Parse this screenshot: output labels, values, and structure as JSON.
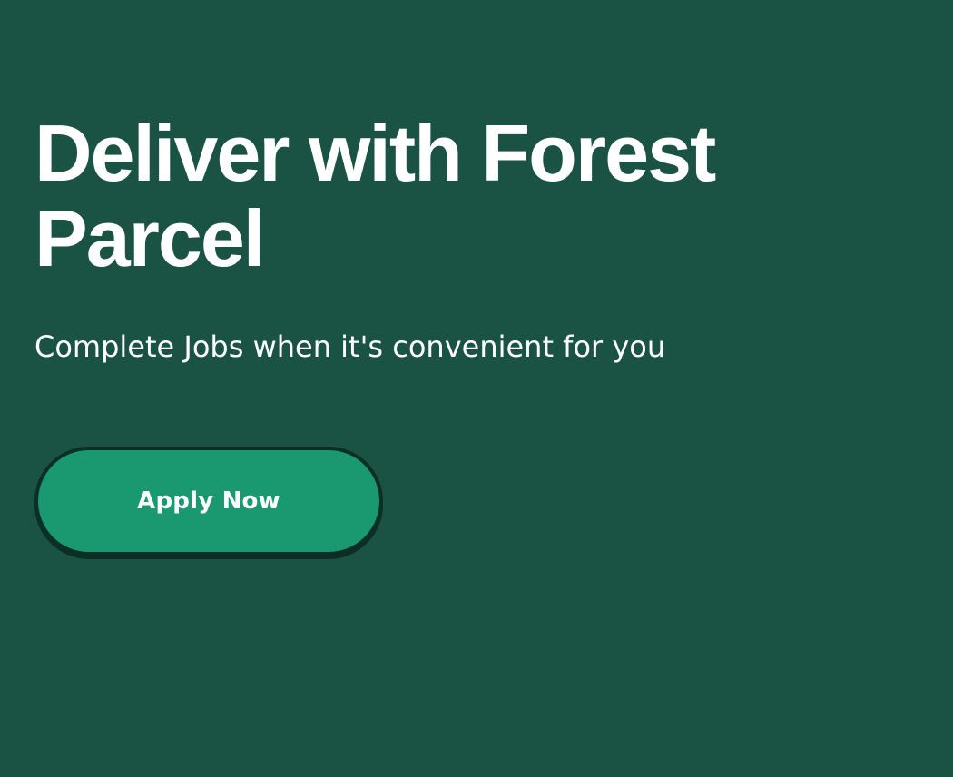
{
  "hero": {
    "title": "Deliver with Forest Parcel",
    "subtitle": "Complete Jobs when it's convenient for you",
    "cta_label": "Apply Now"
  },
  "colors": {
    "background": "#1a5244",
    "button": "#1a9970",
    "button_border": "#0b2f25",
    "text": "#ffffff"
  }
}
